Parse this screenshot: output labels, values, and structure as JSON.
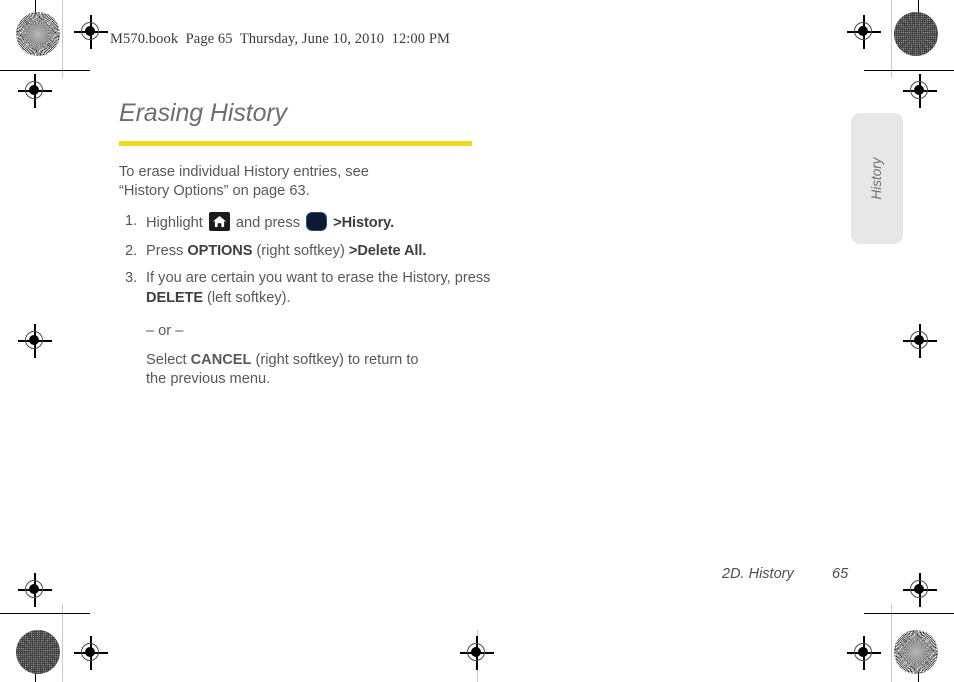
{
  "header": {
    "slug": "M570.book  Page 65  Thursday, June 10, 2010  12:00 PM"
  },
  "content": {
    "title": "Erasing History",
    "intro": "To erase individual History entries, see “History Options” on page 63.",
    "steps": [
      {
        "number": "1.",
        "prefix": "Highlight",
        "icon_1": "home-key-icon",
        "middle": "and press",
        "icon_2": "ok-key-icon",
        "separator": ">",
        "bold_1": "History",
        "suffix": "."
      },
      {
        "number": "2.",
        "prefix": "Press",
        "bold_1": "OPTIONS",
        "middle": "(right softkey)",
        "separator": ">",
        "bold_2": "Delete All",
        "suffix": "."
      },
      {
        "number": "3.",
        "prefix": "If you are certain you want to erase the History, press",
        "bold_1": "DELETE",
        "suffix": "(left softkey)."
      }
    ],
    "or_label": "– or –",
    "alternate": {
      "prefix": "Select",
      "bold_1": "CANCEL",
      "suffix": "(right softkey) to return to the previous menu."
    }
  },
  "side_tab": {
    "label": "History"
  },
  "footer": {
    "section": "2D. History",
    "page_number": "65"
  },
  "colors": {
    "accent_rule": "#edd81e",
    "title_gray": "#6d6e70",
    "body_gray": "#58585a",
    "tab_background": "#e7e7e7",
    "key_black": "#1b1b1b",
    "key_border_blue": "#1f4f8f"
  }
}
